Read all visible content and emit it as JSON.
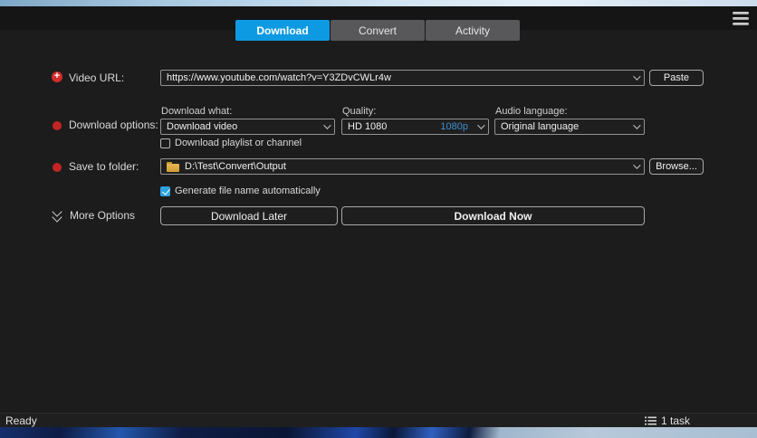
{
  "window": {
    "tabs": [
      {
        "label": "Download",
        "active": true
      },
      {
        "label": "Convert",
        "active": false
      },
      {
        "label": "Activity",
        "active": false
      }
    ],
    "menu_icon": "hamburger-icon"
  },
  "form": {
    "video_url": {
      "label": "Video URL:",
      "value": "https://www.youtube.com/watch?v=Y3ZDvCWLr4w",
      "paste_label": "Paste"
    },
    "options": {
      "label": "Download options:",
      "download_what": {
        "label": "Download what:",
        "value": "Download video"
      },
      "quality": {
        "label": "Quality:",
        "value": "HD 1080",
        "badge": "1080p"
      },
      "audio_language": {
        "label": "Audio language:",
        "value": "Original language"
      },
      "playlist_checkbox": {
        "label": "Download playlist or channel",
        "checked": false
      }
    },
    "save": {
      "label": "Save to folder:",
      "value": "D:\\Test\\Convert\\Output",
      "browse_label": "Browse...",
      "autoname_checkbox": {
        "label": "Generate file name automatically",
        "checked": true
      }
    },
    "more_options_label": "More Options",
    "download_later_label": "Download Later",
    "download_now_label": "Download Now"
  },
  "statusbar": {
    "ready": "Ready",
    "tasks": "1 task"
  },
  "colors": {
    "accent_blue": "#0d9ae2",
    "badge_blue": "#3f8fd0",
    "checkbox_blue": "#2fa3e0",
    "required_red": "#d22b2b",
    "folder_yellow": "#d9a33c",
    "window_bg": "#1c1c1c"
  }
}
